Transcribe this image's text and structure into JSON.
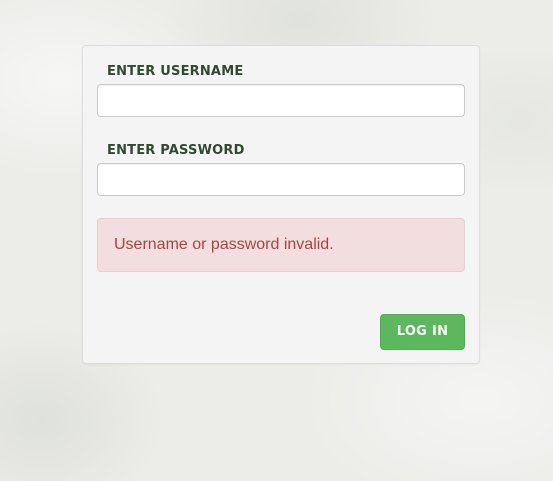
{
  "login_form": {
    "username_label": "ENTER USERNAME",
    "username_value": "",
    "password_label": "ENTER PASSWORD",
    "password_value": "",
    "error_message": "Username or password invalid.",
    "submit_label": "LOG IN"
  },
  "colors": {
    "page_background": "#ecece9",
    "panel_background": "#f4f4f4",
    "label_text": "#2f4a30",
    "error_background": "#f2dede",
    "error_border": "#ebccd1",
    "error_text": "#a94442",
    "button_background": "#5cb85c",
    "button_text": "#ffffff"
  }
}
